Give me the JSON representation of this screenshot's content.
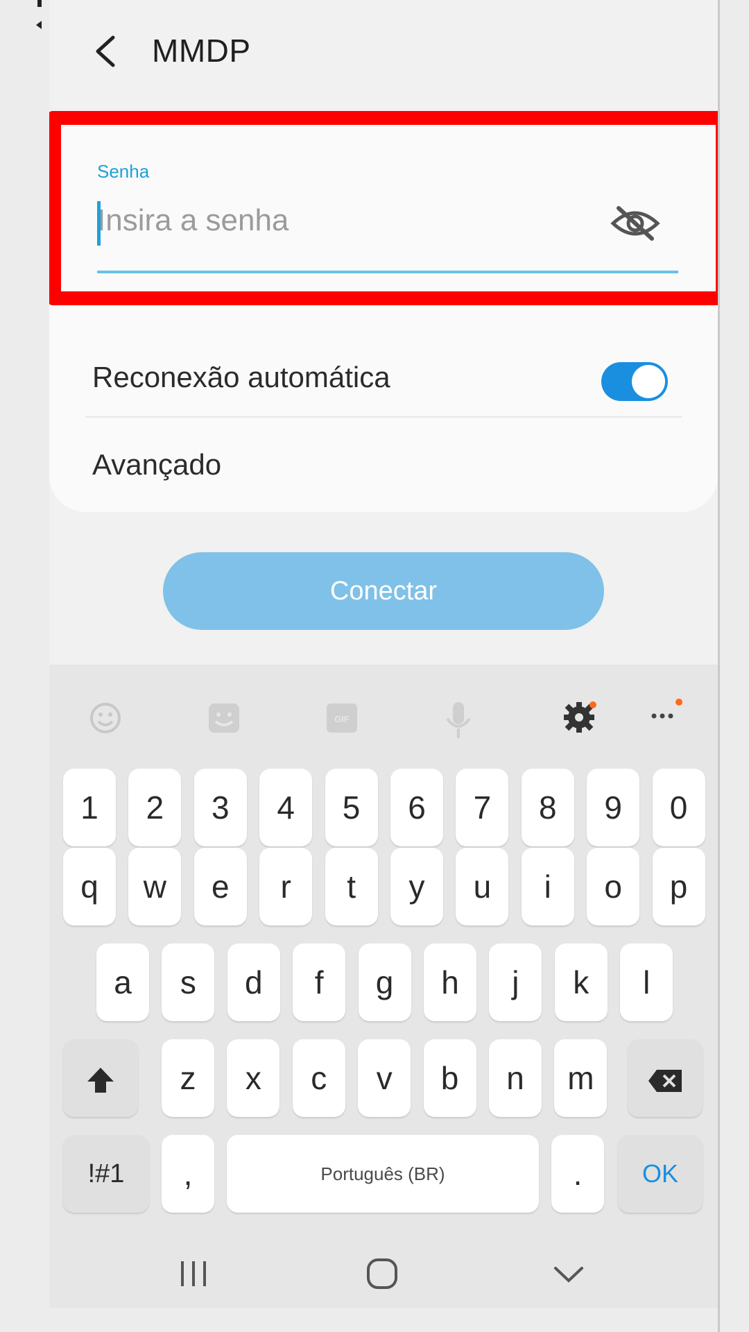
{
  "header": {
    "title": "MMDP"
  },
  "password": {
    "label": "Senha",
    "placeholder": "Insira a senha"
  },
  "settings": {
    "auto_reconnect_label": "Reconexão automática",
    "auto_reconnect_on": true,
    "advanced_label": "Avançado"
  },
  "connect_label": "Conectar",
  "keyboard": {
    "number_row": [
      "1",
      "2",
      "3",
      "4",
      "5",
      "6",
      "7",
      "8",
      "9",
      "0"
    ],
    "row1": [
      "q",
      "w",
      "e",
      "r",
      "t",
      "y",
      "u",
      "i",
      "o",
      "p"
    ],
    "row2": [
      "a",
      "s",
      "d",
      "f",
      "g",
      "h",
      "j",
      "k",
      "l"
    ],
    "row3": [
      "z",
      "x",
      "c",
      "v",
      "b",
      "n",
      "m"
    ],
    "symbols_key": "!#1",
    "comma_key": ",",
    "space_label": "Português (BR)",
    "period_key": ".",
    "ok_key": "OK"
  },
  "colors": {
    "accent": "#1a8fe0",
    "highlight": "#ff0000",
    "connect_disabled": "#7fc1e8"
  }
}
